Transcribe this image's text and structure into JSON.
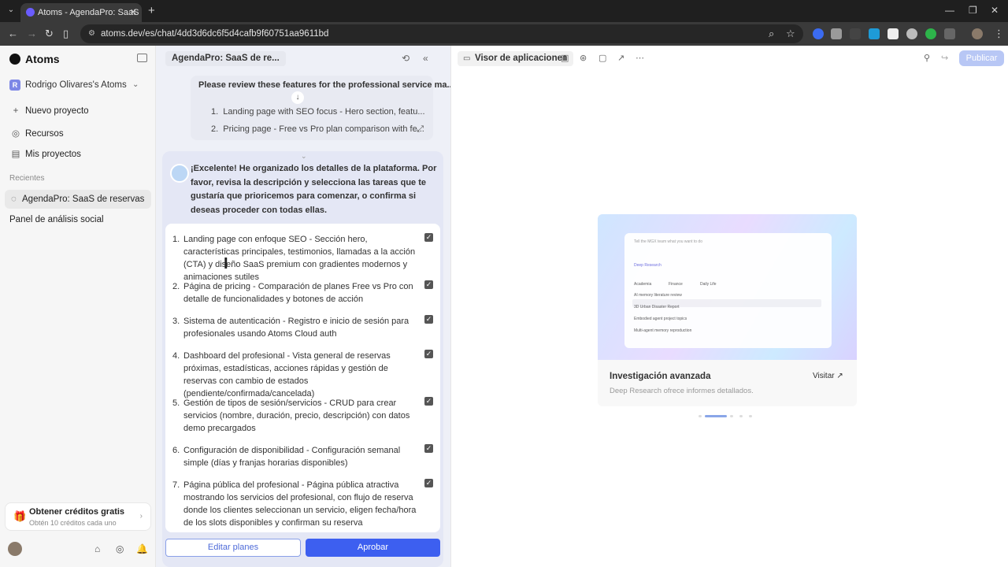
{
  "browser": {
    "tab_title": "Atoms - AgendaPro: SaaS de r",
    "url": "atoms.dev/es/chat/4dd3d6dc6f5d4cafb9f60751aa9611bd"
  },
  "sidebar": {
    "brand": "Atoms",
    "workspace": "Rodrigo Olivares's Atoms",
    "workspace_initial": "R",
    "nav": [
      {
        "label": "Nuevo proyecto"
      },
      {
        "label": "Recursos"
      },
      {
        "label": "Mis proyectos"
      }
    ],
    "recents_label": "Recientes",
    "recents": [
      {
        "label": "AgendaPro: SaaS de reservas"
      },
      {
        "label": "Panel de análisis social"
      }
    ],
    "credits_title": "Obtener créditos gratis",
    "credits_sub": "Obtén 10 créditos cada uno"
  },
  "chat": {
    "title": "AgendaPro: SaaS de re...",
    "user_message": {
      "head": "Please review these features for the professional service ma...",
      "items": [
        "Landing page with SEO focus - Hero section, featu...",
        "Pricing page - Free vs Pro plan comparison with fe..."
      ]
    },
    "bot_message": "¡Excelente! He organizado los detalles de la plataforma. Por favor, revisa la descripción y selecciona las tareas que te gustaría que prioricemos para comenzar, o confirma si deseas proceder con todas ellas.",
    "plans": [
      {
        "n": "1.",
        "text": "Landing page con enfoque SEO - Sección hero, características principales, testimonios, llamadas a la acción (CTA) y diseño SaaS premium con gradientes modernos y animaciones sutiles"
      },
      {
        "n": "2.",
        "text": "Página de pricing - Comparación de planes Free vs Pro con detalle de funcionalidades y botones de acción"
      },
      {
        "n": "3.",
        "text": "Sistema de autenticación - Registro e inicio de sesión para profesionales usando Atoms Cloud auth"
      },
      {
        "n": "4.",
        "text": "Dashboard del profesional - Vista general de reservas próximas, estadísticas, acciones rápidas y gestión de reservas con cambio de estados (pendiente/confirmada/cancelada)"
      },
      {
        "n": "5.",
        "text": "Gestión de tipos de sesión/servicios - CRUD para crear servicios (nombre, duración, precio, descripción) con datos demo precargados"
      },
      {
        "n": "6.",
        "text": "Configuración de disponibilidad - Configuración semanal simple (días y franjas horarias disponibles)"
      },
      {
        "n": "7.",
        "text": "Página pública del profesional - Página pública atractiva mostrando los servicios del profesional, con flujo de reserva donde los clientes seleccionan un servicio, eligen fecha/hora de los slots disponibles y confirman su reserva"
      }
    ],
    "edit_label": "Editar planes",
    "approve_label": "Aprobar"
  },
  "viewer": {
    "title": "Visor de aplicaciones",
    "publish_label": "Publicar",
    "card": {
      "title": "Investigación avanzada",
      "description": "Deep Research ofrece informes detallados.",
      "visit_label": "Visitar",
      "mock_prompt": "Tell the MGX team what you want to do",
      "mock_chip": "Deep Research",
      "mock_tabs": [
        "Academia",
        "Finance",
        "Daily Life"
      ],
      "mock_rows": [
        "AI memory literature review",
        "3D Urban Disaster Report",
        "Embodied agent project topics",
        "Multi-agent memory reproduction"
      ]
    },
    "carousel": {
      "count": 5,
      "active": 0
    }
  },
  "colors": {
    "accent": "#3d5ff0",
    "publish": "#b8c7f5"
  }
}
